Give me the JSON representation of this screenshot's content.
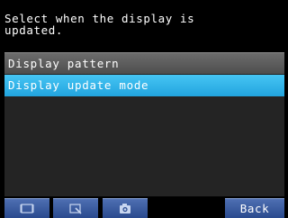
{
  "help_text": "Select when the display is\nupdated.",
  "menu": {
    "items": [
      {
        "label": "Display pattern",
        "selected": false
      },
      {
        "label": "Display update mode",
        "selected": true
      }
    ]
  },
  "toolbar": {
    "icons": [
      "fit-screen-icon",
      "zoom-select-icon",
      "camera-icon"
    ],
    "back_label": "Back"
  },
  "colors": {
    "background": "#000000",
    "selected_item": "#2db4ea",
    "unselected_item": "#5c5c5c",
    "button": "#3a5ba0"
  }
}
